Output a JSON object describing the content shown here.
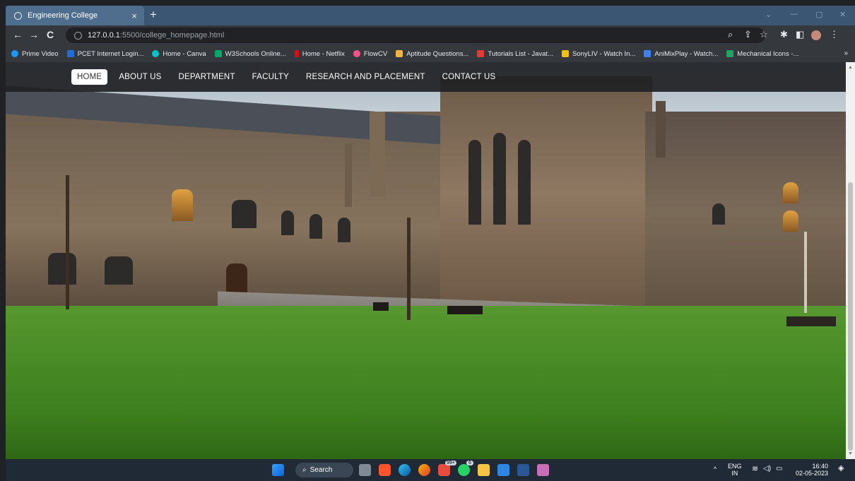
{
  "browser": {
    "tab_title": "Engineering College",
    "tab_close": "×",
    "new_tab": "+",
    "url_host": "127.0.0.1",
    "url_path": ":5500/college_homepage.html",
    "bookmarks": [
      {
        "label": "Prime Video",
        "color": "#1a98ff"
      },
      {
        "label": "PCET Internet Login...",
        "color": "#1e6fd9"
      },
      {
        "label": "Home - Canva",
        "color": "#00c4cc"
      },
      {
        "label": "W3Schools Online...",
        "color": "#04aa6d"
      },
      {
        "label": "Home - Netflix",
        "color": "#e50914"
      },
      {
        "label": "FlowCV",
        "color": "#ff4f8b"
      },
      {
        "label": "Aptitude Questions...",
        "color": "#f2b43c"
      },
      {
        "label": "Tutorials List - Javat...",
        "color": "#e53935"
      },
      {
        "label": "SonyLIV - Watch In...",
        "color": "#f4c20d"
      },
      {
        "label": "AniMixPlay - Watch...",
        "color": "#3b82f6"
      },
      {
        "label": "Mechanical Icons -...",
        "color": "#21a366"
      }
    ],
    "bookmarks_more": "»"
  },
  "site": {
    "nav": [
      {
        "label": "HOME",
        "active": true
      },
      {
        "label": "ABOUT US",
        "active": false
      },
      {
        "label": "DEPARTMENT",
        "active": false
      },
      {
        "label": "FACULTY",
        "active": false
      },
      {
        "label": "RESEARCH AND PLACEMENT",
        "active": false
      },
      {
        "label": "CONTACT US",
        "active": false
      }
    ]
  },
  "taskbar": {
    "search_label": "Search",
    "lang_top": "ENG",
    "lang_bottom": "IN",
    "time": "16:40",
    "date": "02-05-2023",
    "badge_99": "99+",
    "badge_6": "6"
  }
}
